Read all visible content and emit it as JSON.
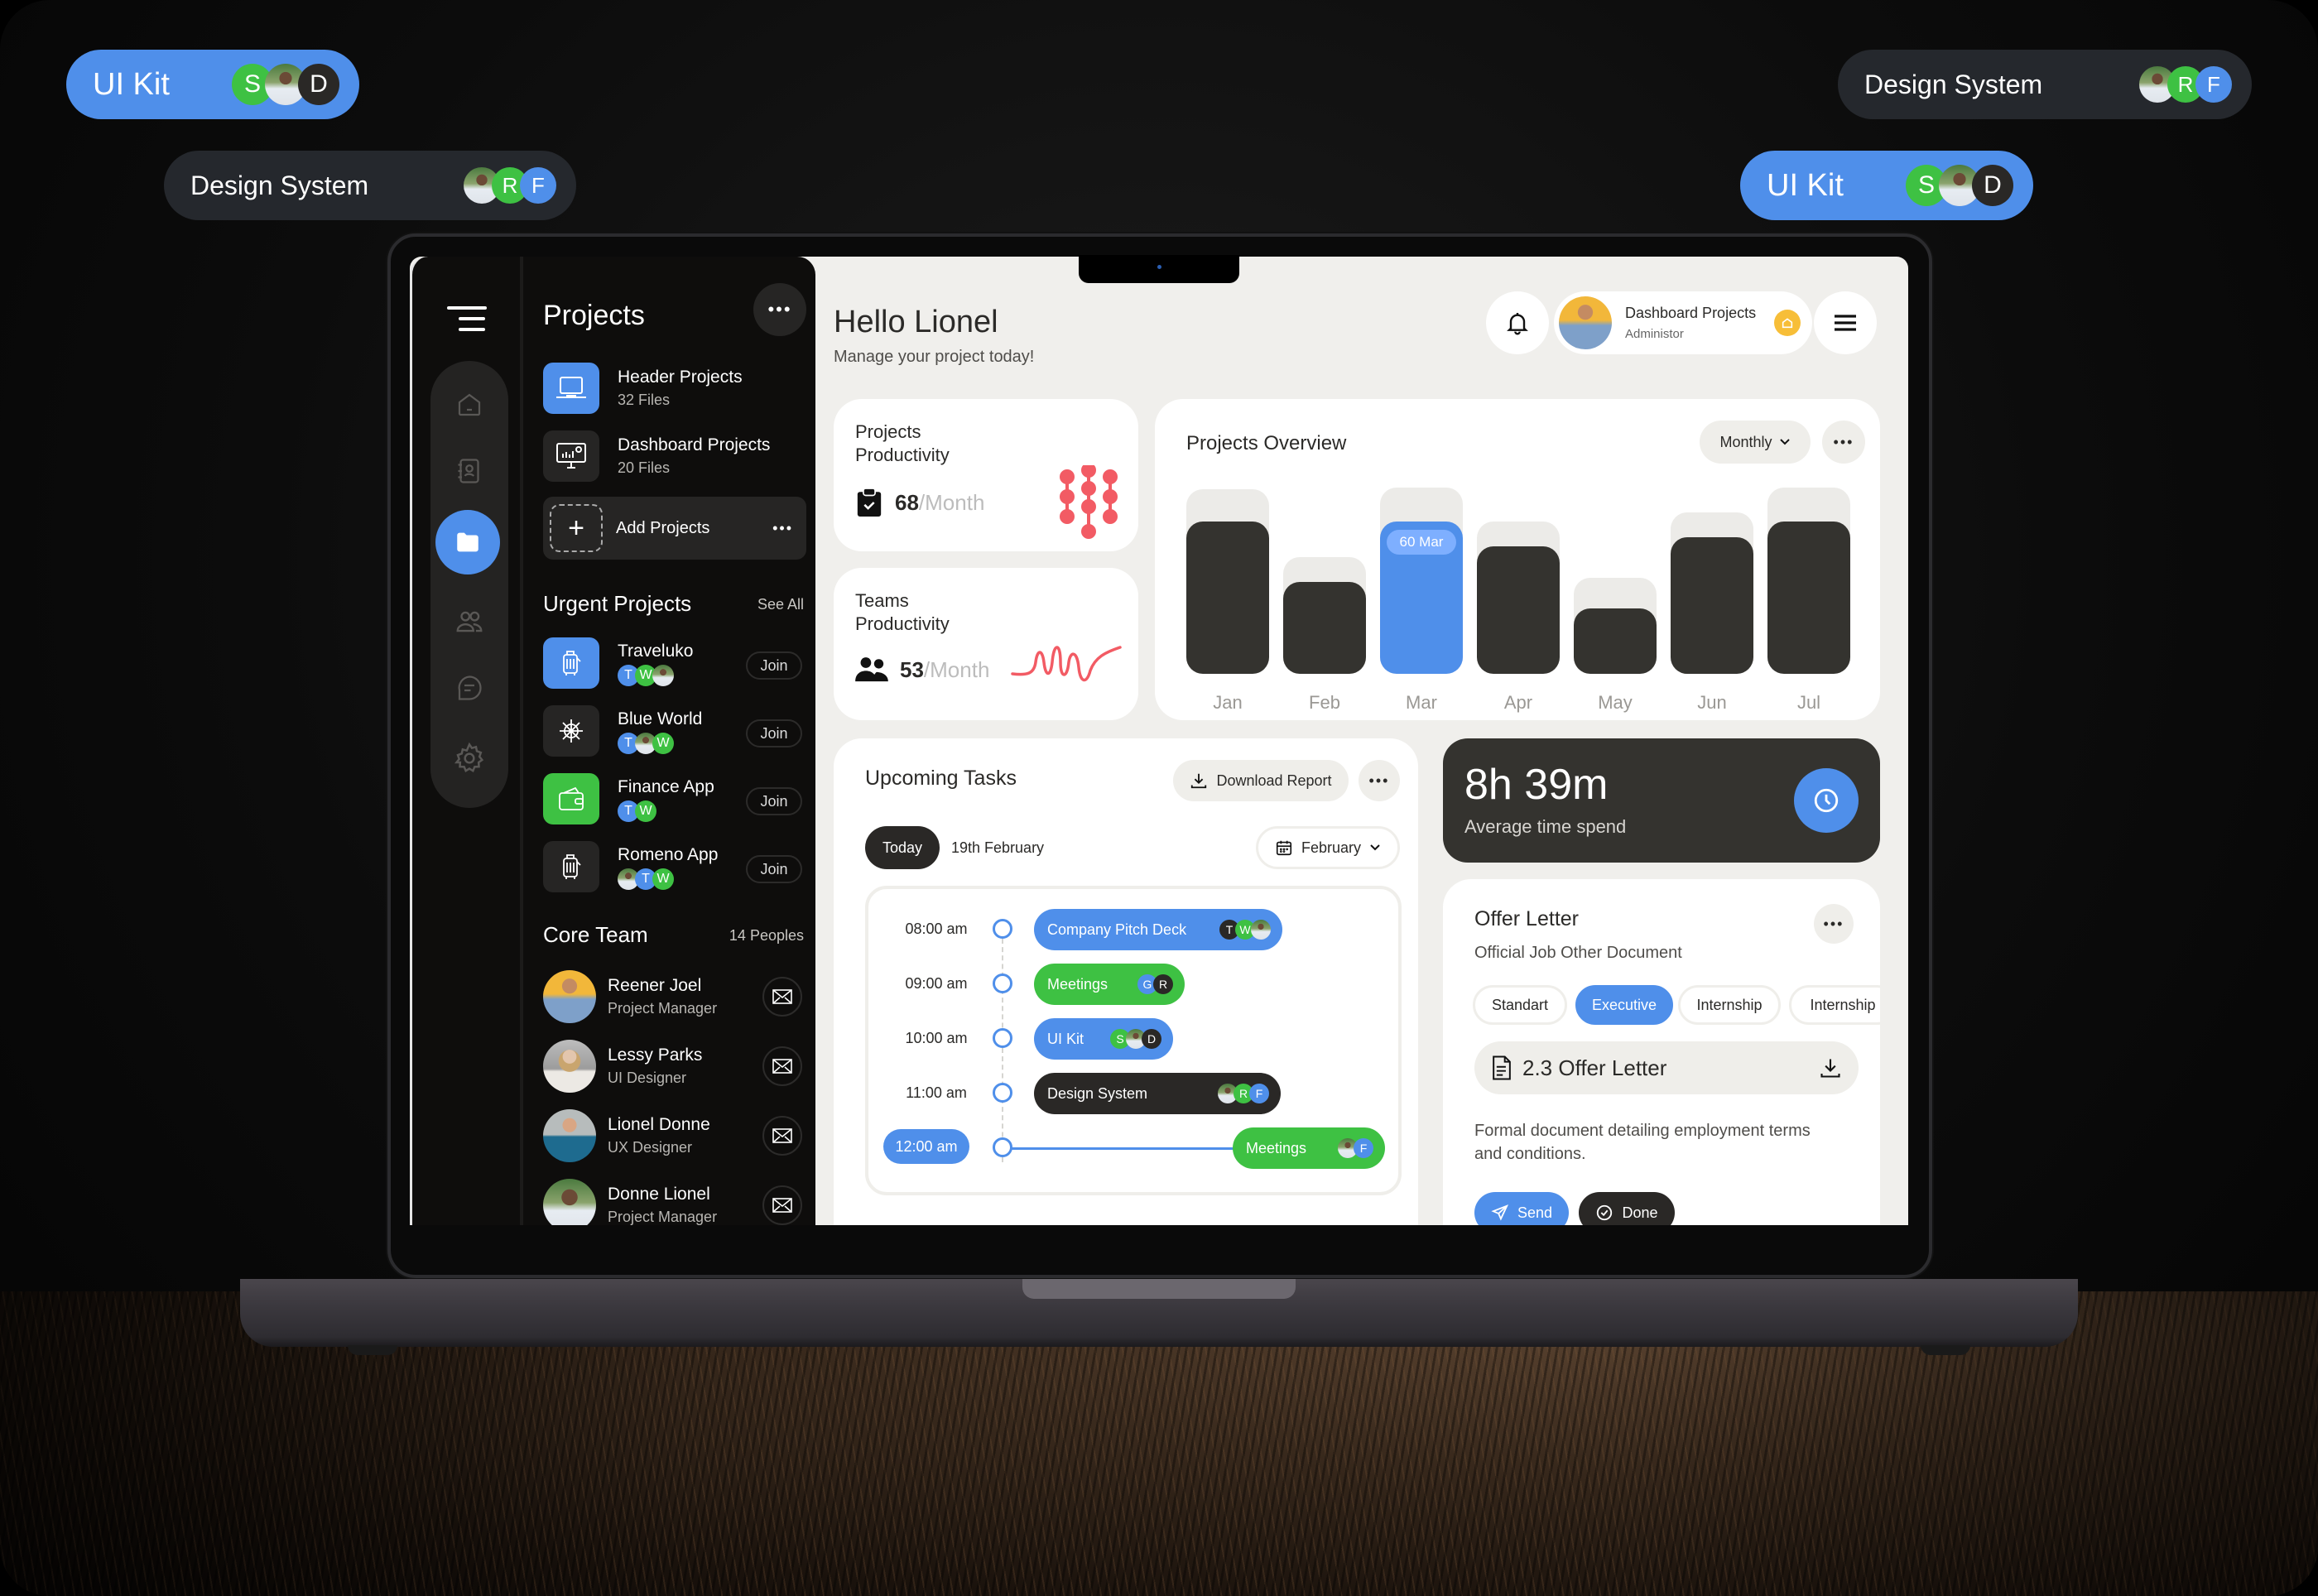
{
  "floating_pills": [
    {
      "label": "UI Kit",
      "avatars": [
        "S",
        "photo",
        "D"
      ],
      "style": "blue"
    },
    {
      "label": "Design System",
      "avatars": [
        "photo",
        "R",
        "F"
      ],
      "style": "dark"
    },
    {
      "label": "Design System",
      "avatars": [
        "photo",
        "R",
        "F"
      ],
      "style": "dark"
    },
    {
      "label": "UI Kit",
      "avatars": [
        "S",
        "photo",
        "D"
      ],
      "style": "blue"
    }
  ],
  "nav": {
    "items": [
      "home-icon",
      "contacts-icon",
      "folder-icon",
      "users-icon",
      "chat-icon",
      "settings-icon"
    ],
    "active": "folder-icon"
  },
  "projects": {
    "title": "Projects",
    "items": [
      {
        "name": "Header Projects",
        "files": "32 Files",
        "icon": "laptop-icon"
      },
      {
        "name": "Dashboard Projects",
        "files": "20 Files",
        "icon": "monitor-chart-icon"
      }
    ],
    "add_label": "Add Projects"
  },
  "urgent": {
    "title": "Urgent Projects",
    "see_all": "See All",
    "join_label": "Join",
    "items": [
      {
        "name": "Traveluko",
        "icon": "luggage-icon",
        "avatars": [
          "T",
          "W",
          "photo"
        ]
      },
      {
        "name": "Blue World",
        "icon": "ship-wheel-icon",
        "avatars": [
          "T",
          "photo",
          "W"
        ]
      },
      {
        "name": "Finance App",
        "icon": "wallet-icon",
        "avatars": [
          "T",
          "W"
        ]
      },
      {
        "name": "Romeno App",
        "icon": "luggage-icon",
        "avatars": [
          "photo",
          "T",
          "W"
        ]
      }
    ]
  },
  "team": {
    "title": "Core Team",
    "count": "14 Peoples",
    "members": [
      {
        "name": "Reener Joel",
        "role": "Project Manager"
      },
      {
        "name": "Lessy Parks",
        "role": "UI Designer"
      },
      {
        "name": "Lionel Donne",
        "role": "UX Designer"
      },
      {
        "name": "Donne Lionel",
        "role": "Project Manager"
      }
    ]
  },
  "header": {
    "greeting": "Hello Lionel",
    "subtitle": "Manage your project today!",
    "user_title": "Dashboard Projects",
    "user_role": "Administor"
  },
  "stats": {
    "projects": {
      "title_1": "Projects",
      "title_2": "Productivity",
      "value": "68",
      "unit": "/Month"
    },
    "teams": {
      "title_1": "Teams",
      "title_2": "Productivity",
      "value": "53",
      "unit": "/Month"
    }
  },
  "chart_data": {
    "type": "bar",
    "title": "Projects Overview",
    "period": "Monthly",
    "categories": [
      "Jan",
      "Feb",
      "Mar",
      "Apr",
      "May",
      "Jun",
      "Jul"
    ],
    "values": [
      86,
      52,
      86,
      72,
      37,
      77,
      86
    ],
    "capacity": [
      104,
      66,
      105,
      86,
      54,
      91,
      105
    ],
    "highlight": {
      "category": "Mar",
      "label": "60 Mar"
    },
    "ylim": [
      0,
      105
    ],
    "colors": {
      "bar": "#34332f",
      "highlight": "#4f8fea",
      "track": "#ecebe8"
    }
  },
  "tasks": {
    "title": "Upcoming Tasks",
    "download_label": "Download Report",
    "today_label": "Today",
    "date": "19th February",
    "month": "February",
    "rows": [
      {
        "time": "08:00 am",
        "label": "Company Pitch Deck",
        "color": "blue",
        "avatars": [
          "T",
          "W",
          "photo"
        ]
      },
      {
        "time": "09:00 am",
        "label": "Meetings",
        "color": "green",
        "avatars": [
          "G",
          "R"
        ]
      },
      {
        "time": "10:00 am",
        "label": "UI Kit",
        "color": "blue",
        "avatars": [
          "S",
          "photo",
          "D"
        ]
      },
      {
        "time": "11:00 am",
        "label": "Design System",
        "color": "dark",
        "avatars": [
          "photo",
          "R",
          "F"
        ]
      },
      {
        "time": "12:00 am",
        "label": "Meetings",
        "color": "green",
        "avatars": [
          "photo",
          "F"
        ],
        "current": true
      }
    ]
  },
  "time_card": {
    "value": "8h 39m",
    "label": "Average time spend"
  },
  "offer": {
    "title": "Offer Letter",
    "subtitle": "Official Job Other Document",
    "tags": [
      "Standart",
      "Executive",
      "Internship",
      "Internship"
    ],
    "active_tag": "Executive",
    "file_name": "2.3 Offer Letter",
    "description": "Formal document detailing employment terms and conditions.",
    "send_label": "Send",
    "done_label": "Done"
  },
  "colors": {
    "accent": "#4f8fea",
    "green": "#3ec143",
    "dark": "#2a2826",
    "coral": "#f25b64",
    "yellow": "#f7be38"
  }
}
